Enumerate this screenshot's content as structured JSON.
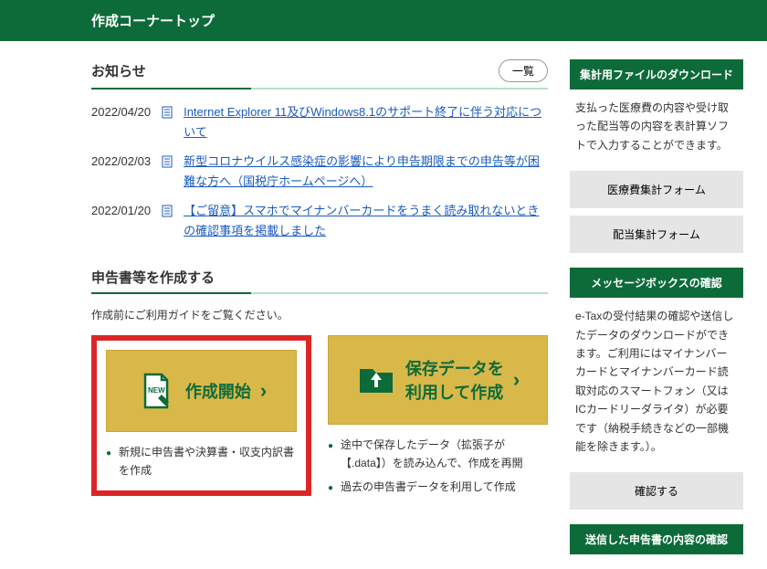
{
  "header": {
    "title": "作成コーナートップ"
  },
  "notice": {
    "heading": "お知らせ",
    "listButton": "一覧",
    "items": [
      {
        "date": "2022/04/20",
        "text": "Internet Explorer 11及びWindows8.1のサポート終了に伴う対応について"
      },
      {
        "date": "2022/02/03",
        "text": "新型コロナウイルス感染症の影響により申告期限までの申告等が困難な方へ（国税庁ホームページへ）"
      },
      {
        "date": "2022/01/20",
        "text": "【ご留意】スマホでマイナンバーカードをうまく読み取れないときの確認事項を掲載しました"
      }
    ]
  },
  "create": {
    "heading": "申告書等を作成する",
    "guide": "作成前にご利用ガイドをご覧ください。",
    "newBtn": {
      "badge": "NEW",
      "label": "作成開始"
    },
    "loadBtn": {
      "label": "保存データを\n利用して作成"
    },
    "newBullets": [
      "新規に申告書や決算書・収支内訳書を作成"
    ],
    "loadBullets": [
      "途中で保存したデータ（拡張子が【.data】）を読み込んで、作成を再開",
      "過去の申告書データを利用して作成"
    ]
  },
  "sidebar": {
    "download": {
      "title": "集計用ファイルのダウンロード",
      "body": "支払った医療費の内容や受け取った配当等の内容を表計算ソフトで入力することができます。",
      "btn1": "医療費集計フォーム",
      "btn2": "配当集計フォーム"
    },
    "msgbox": {
      "title": "メッセージボックスの確認",
      "body": "e-Taxの受付結果の確認や送信したデータのダウンロードができます。ご利用にはマイナンバーカードとマイナンバーカード読取対応のスマートフォン（又はICカードリーダライタ）が必要です（納税手続きなどの一部機能を除きます。）。",
      "btn": "確認する"
    },
    "sent": {
      "title": "送信した申告書の内容の確認"
    }
  }
}
